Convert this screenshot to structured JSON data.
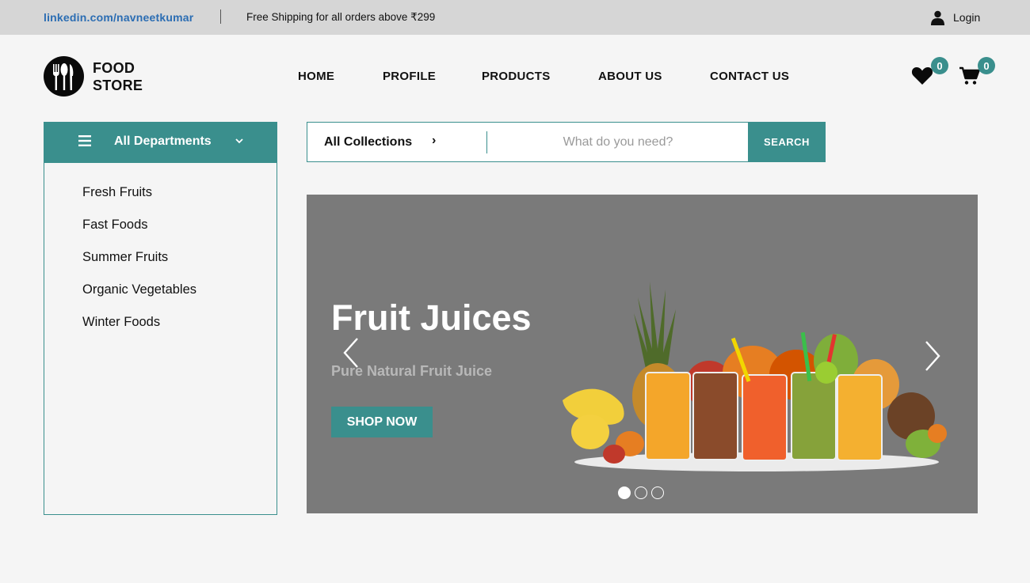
{
  "topbar": {
    "link": "linkedin.com/navneetkumar",
    "shipping": "Free Shipping for all orders above ₹299",
    "login": "Login"
  },
  "logo": {
    "line1": "FOOD",
    "line2": "STORE"
  },
  "nav": [
    "HOME",
    "PROFILE",
    "PRODUCTS",
    "ABOUT US",
    "CONTACT US"
  ],
  "wishlist": {
    "count": "0",
    "icon": "heart-icon"
  },
  "cart": {
    "count": "0",
    "icon": "cart-icon"
  },
  "departments": {
    "title": "All Departments",
    "items": [
      "Fresh Fruits",
      "Fast Foods",
      "Summer Fruits",
      "Organic Vegetables",
      "Winter Foods"
    ]
  },
  "search": {
    "collection": "All Collections",
    "arrow": "›",
    "placeholder": "What do you need?",
    "button": "SEARCH"
  },
  "hero": {
    "title": "Fruit Juices",
    "subtitle": "Pure Natural Fruit Juice",
    "button": "SHOP NOW",
    "slides": 3,
    "active_slide": 1
  },
  "colors": {
    "accent": "#3a8f8d",
    "hero_bg": "#7a7a7a",
    "link": "#2b6db3"
  }
}
